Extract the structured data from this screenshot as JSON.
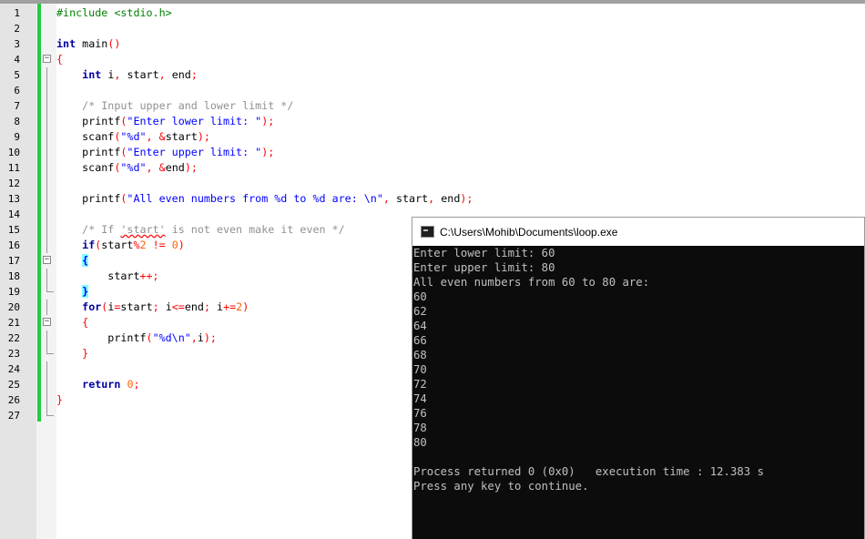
{
  "editor": {
    "line_numbers": [
      "1",
      "2",
      "3",
      "4",
      "5",
      "6",
      "7",
      "8",
      "9",
      "10",
      "11",
      "12",
      "13",
      "14",
      "15",
      "16",
      "17",
      "18",
      "19",
      "20",
      "21",
      "22",
      "23",
      "24",
      "25",
      "26",
      "27"
    ],
    "lines": [
      [
        {
          "t": "#include <stdio.h>",
          "c": "pp"
        }
      ],
      [],
      [
        {
          "t": "int",
          "c": "kw"
        },
        {
          "t": " main"
        },
        {
          "t": "()",
          "c": "br"
        }
      ],
      [
        {
          "t": "{",
          "c": "br"
        }
      ],
      [
        {
          "t": "    "
        },
        {
          "t": "int",
          "c": "kw"
        },
        {
          "t": " i"
        },
        {
          "t": ",",
          "c": "op"
        },
        {
          "t": " start"
        },
        {
          "t": ",",
          "c": "op"
        },
        {
          "t": " end"
        },
        {
          "t": ";",
          "c": "op"
        }
      ],
      [],
      [
        {
          "t": "    "
        },
        {
          "t": "/* Input upper and lower limit */",
          "c": "cm"
        }
      ],
      [
        {
          "t": "    printf"
        },
        {
          "t": "(",
          "c": "br"
        },
        {
          "t": "\"Enter lower limit: \"",
          "c": "st"
        },
        {
          "t": ");",
          "c": "br"
        }
      ],
      [
        {
          "t": "    scanf"
        },
        {
          "t": "(",
          "c": "br"
        },
        {
          "t": "\"%d\"",
          "c": "st"
        },
        {
          "t": ",",
          "c": "op"
        },
        {
          "t": " "
        },
        {
          "t": "&",
          "c": "op"
        },
        {
          "t": "start"
        },
        {
          "t": ");",
          "c": "br"
        }
      ],
      [
        {
          "t": "    printf"
        },
        {
          "t": "(",
          "c": "br"
        },
        {
          "t": "\"Enter upper limit: \"",
          "c": "st"
        },
        {
          "t": ");",
          "c": "br"
        }
      ],
      [
        {
          "t": "    scanf"
        },
        {
          "t": "(",
          "c": "br"
        },
        {
          "t": "\"%d\"",
          "c": "st"
        },
        {
          "t": ",",
          "c": "op"
        },
        {
          "t": " "
        },
        {
          "t": "&",
          "c": "op"
        },
        {
          "t": "end"
        },
        {
          "t": ");",
          "c": "br"
        }
      ],
      [],
      [
        {
          "t": "    printf"
        },
        {
          "t": "(",
          "c": "br"
        },
        {
          "t": "\"All even numbers from %d to %d are: \\n\"",
          "c": "st"
        },
        {
          "t": ",",
          "c": "op"
        },
        {
          "t": " start"
        },
        {
          "t": ",",
          "c": "op"
        },
        {
          "t": " end"
        },
        {
          "t": ");",
          "c": "br"
        }
      ],
      [],
      [
        {
          "t": "    "
        },
        {
          "t": "/* If ",
          "c": "cm"
        },
        {
          "t": "'start'",
          "c": "cm ul"
        },
        {
          "t": " is not even make it even */",
          "c": "cm"
        }
      ],
      [
        {
          "t": "    "
        },
        {
          "t": "if",
          "c": "kw"
        },
        {
          "t": "(",
          "c": "br"
        },
        {
          "t": "start"
        },
        {
          "t": "%",
          "c": "op"
        },
        {
          "t": "2",
          "c": "nu"
        },
        {
          "t": " "
        },
        {
          "t": "!=",
          "c": "op"
        },
        {
          "t": " "
        },
        {
          "t": "0",
          "c": "nu"
        },
        {
          "t": ")",
          "c": "br"
        }
      ],
      [
        {
          "t": "    "
        },
        {
          "t": "{",
          "c": "bh"
        }
      ],
      [
        {
          "t": "        start"
        },
        {
          "t": "++;",
          "c": "op"
        }
      ],
      [
        {
          "t": "    "
        },
        {
          "t": "}",
          "c": "bh"
        }
      ],
      [
        {
          "t": "    "
        },
        {
          "t": "for",
          "c": "kw"
        },
        {
          "t": "(",
          "c": "br"
        },
        {
          "t": "i"
        },
        {
          "t": "=",
          "c": "op"
        },
        {
          "t": "start"
        },
        {
          "t": ";",
          "c": "op"
        },
        {
          "t": " i"
        },
        {
          "t": "<=",
          "c": "op"
        },
        {
          "t": "end"
        },
        {
          "t": ";",
          "c": "op"
        },
        {
          "t": " i"
        },
        {
          "t": "+=",
          "c": "op"
        },
        {
          "t": "2",
          "c": "nu"
        },
        {
          "t": ")",
          "c": "br"
        }
      ],
      [
        {
          "t": "    "
        },
        {
          "t": "{",
          "c": "br"
        }
      ],
      [
        {
          "t": "        printf"
        },
        {
          "t": "(",
          "c": "br"
        },
        {
          "t": "\"%d\\n\"",
          "c": "st"
        },
        {
          "t": ",",
          "c": "op"
        },
        {
          "t": "i"
        },
        {
          "t": ");",
          "c": "br"
        }
      ],
      [
        {
          "t": "    "
        },
        {
          "t": "}",
          "c": "br"
        }
      ],
      [],
      [
        {
          "t": "    "
        },
        {
          "t": "return",
          "c": "kw"
        },
        {
          "t": " "
        },
        {
          "t": "0",
          "c": "nu"
        },
        {
          "t": ";",
          "c": "op"
        }
      ],
      [
        {
          "t": "}",
          "c": "br"
        }
      ],
      []
    ],
    "folds": {
      "4": "box",
      "5": "line",
      "6": "line",
      "7": "line",
      "8": "line",
      "9": "line",
      "10": "line",
      "11": "line",
      "12": "line",
      "13": "line",
      "14": "line",
      "15": "line",
      "16": "line",
      "17": "box",
      "18": "line",
      "19": "end",
      "20": "line",
      "21": "box",
      "22": "line",
      "23": "end",
      "24": "line",
      "25": "line",
      "26": "line",
      "27": "end"
    }
  },
  "console": {
    "title": "C:\\Users\\Mohib\\Documents\\loop.exe",
    "output": [
      "Enter lower limit: 60",
      "Enter upper limit: 80",
      "All even numbers from 60 to 80 are:",
      "60",
      "62",
      "64",
      "66",
      "68",
      "70",
      "72",
      "74",
      "76",
      "78",
      "80",
      "",
      "Process returned 0 (0x0)   execution time : 12.383 s",
      "Press any key to continue."
    ]
  }
}
